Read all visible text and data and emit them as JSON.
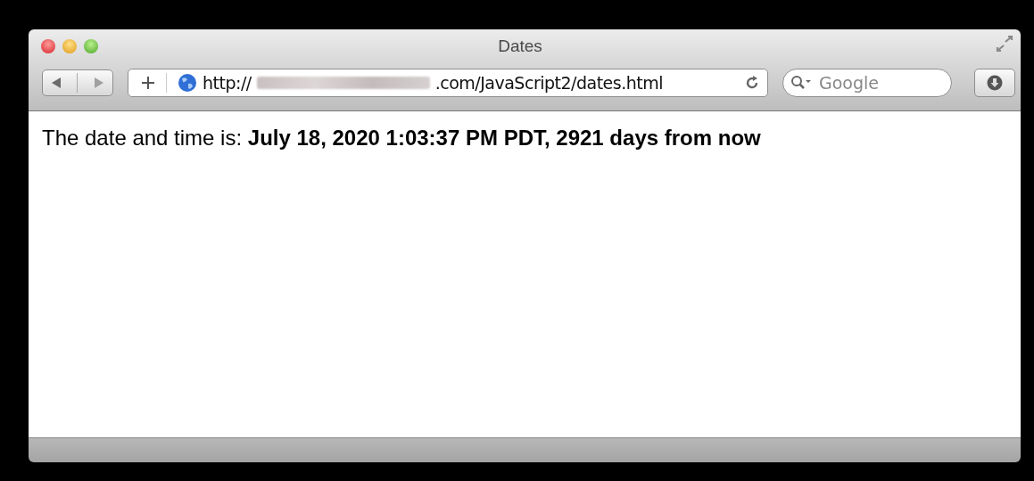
{
  "window": {
    "title": "Dates"
  },
  "toolbar": {
    "url_prefix": "http://",
    "url_suffix": ".com/JavaScript2/dates.html",
    "search": {
      "placeholder": "Google"
    }
  },
  "content": {
    "text": "The date and time is: **July 18, 2020 1:03:37 PM PDT, 2921 days from now**"
  }
}
